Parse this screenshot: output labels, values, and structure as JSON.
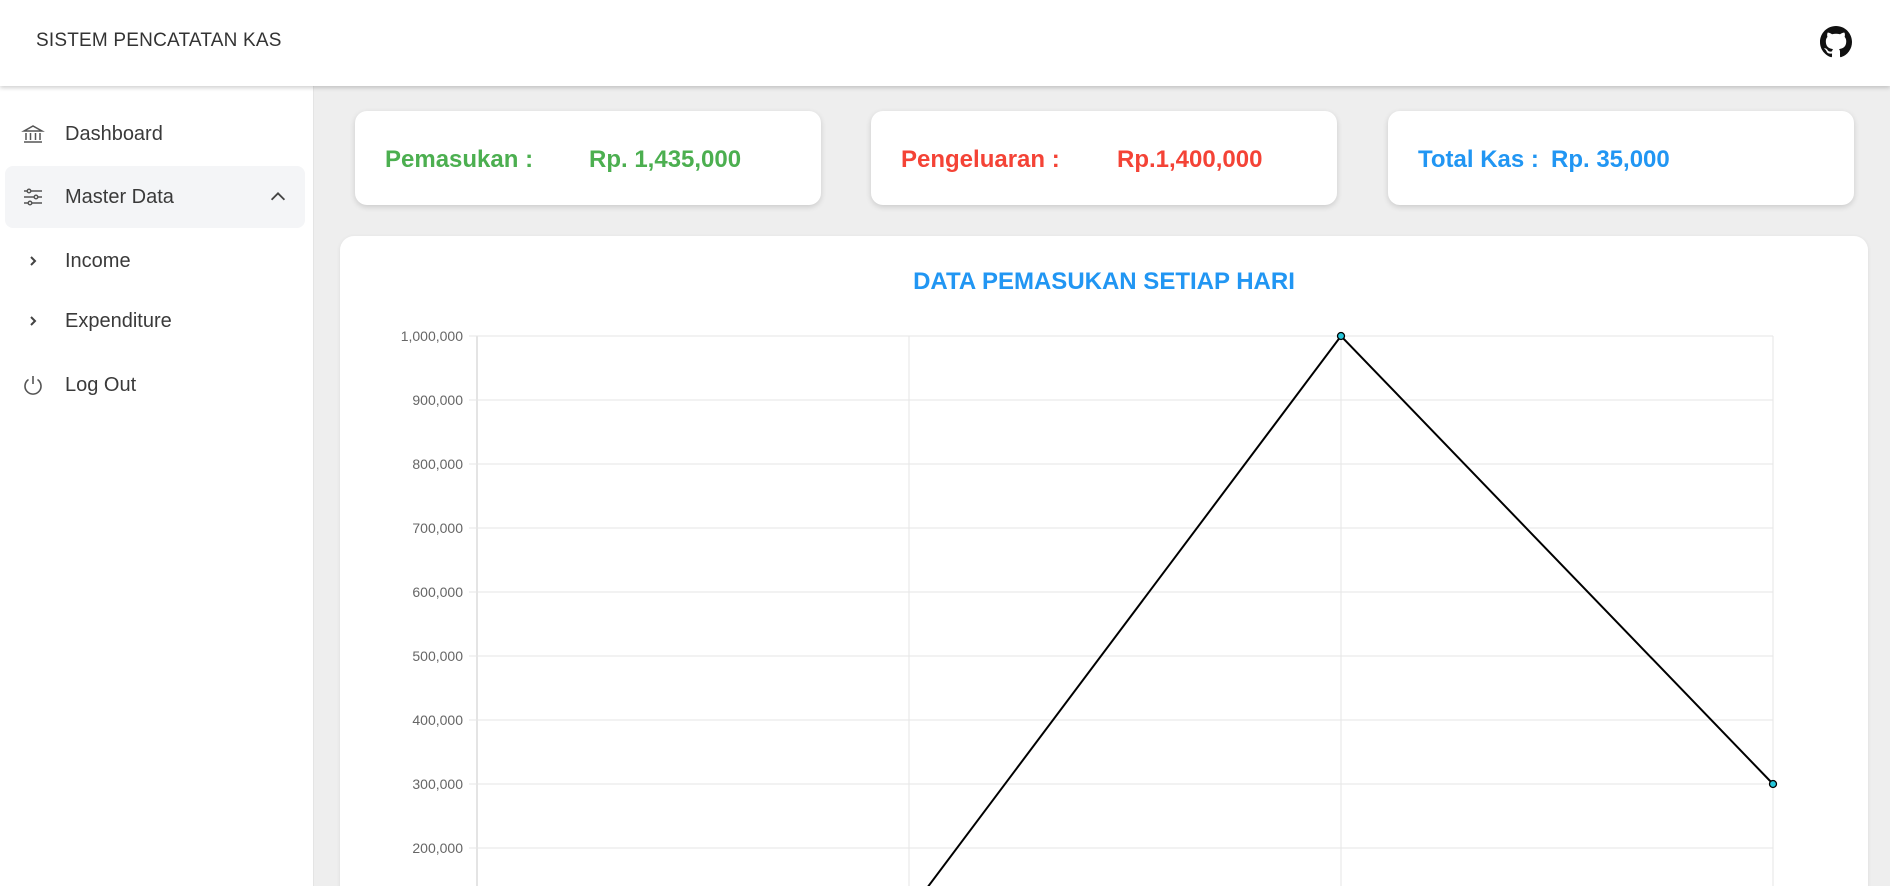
{
  "header": {
    "title": "SISTEM PENCATATAN KAS",
    "github_icon": "github-icon"
  },
  "sidebar": {
    "items": [
      {
        "label": "Dashboard",
        "icon": "bank-icon"
      },
      {
        "label": "Master Data",
        "icon": "sliders-icon",
        "expanded": true
      },
      {
        "label": "Income",
        "icon": "chevron-right-icon"
      },
      {
        "label": "Expenditure",
        "icon": "chevron-right-icon"
      },
      {
        "label": "Log Out",
        "icon": "power-icon"
      }
    ]
  },
  "summary": {
    "income": {
      "label": "Pemasukan :",
      "value": "Rp. 1,435,000",
      "color": "#4caf50"
    },
    "expense": {
      "label": "Pengeluaran :",
      "value": "Rp.1,400,000",
      "color": "#f44336"
    },
    "total": {
      "label": "Total Kas :",
      "value": "Rp. 35,000",
      "color": "#2196f3"
    }
  },
  "chart_data": {
    "type": "line",
    "title": "DATA PEMASUKAN SETIAP HARI",
    "xlabel": "",
    "ylabel": "",
    "y_ticks": [
      "1,000,000",
      "900,000",
      "800,000",
      "700,000",
      "600,000",
      "500,000",
      "400,000",
      "300,000",
      "200,000"
    ],
    "ylim_visible": [
      200000,
      1000000
    ],
    "grid": true,
    "series": [
      {
        "values": [
          null,
          100000,
          1000000,
          300000
        ],
        "color": "#000000",
        "point_color": "#26c6da"
      }
    ]
  }
}
